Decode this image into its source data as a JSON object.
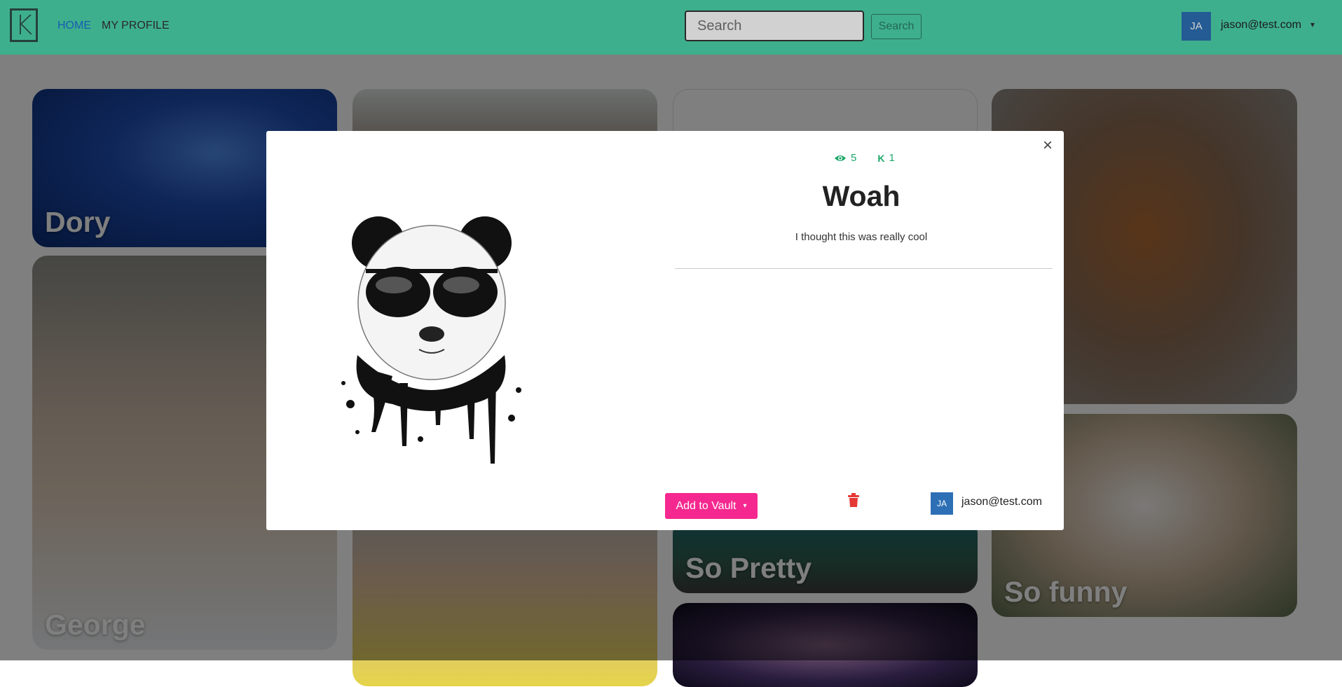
{
  "nav": {
    "logo": "K",
    "home": "HOME",
    "profile": "MY PROFILE",
    "search_placeholder": "Search",
    "search_button": "Search",
    "avatar_initials": "JA",
    "user_email": "jason@test.com",
    "caret": "▾"
  },
  "cards": {
    "dory": "Dory",
    "george": "George",
    "pretty": "So Pretty",
    "funny": "So funny"
  },
  "modal": {
    "views": "5",
    "keeps": "1",
    "keep_glyph": "K",
    "title": "Woah",
    "description": "I thought this was really cool",
    "close": "×",
    "vault_button": "Add to Vault",
    "vault_caret": "▾",
    "avatar_initials": "JA",
    "user_email": "jason@test.com"
  },
  "colors": {
    "navbar": "#4cd6ad",
    "accent_pink": "#f5288f",
    "stat_green": "#1fa86a",
    "trash_red": "#e53935",
    "avatar_blue": "#2d6fb5"
  }
}
